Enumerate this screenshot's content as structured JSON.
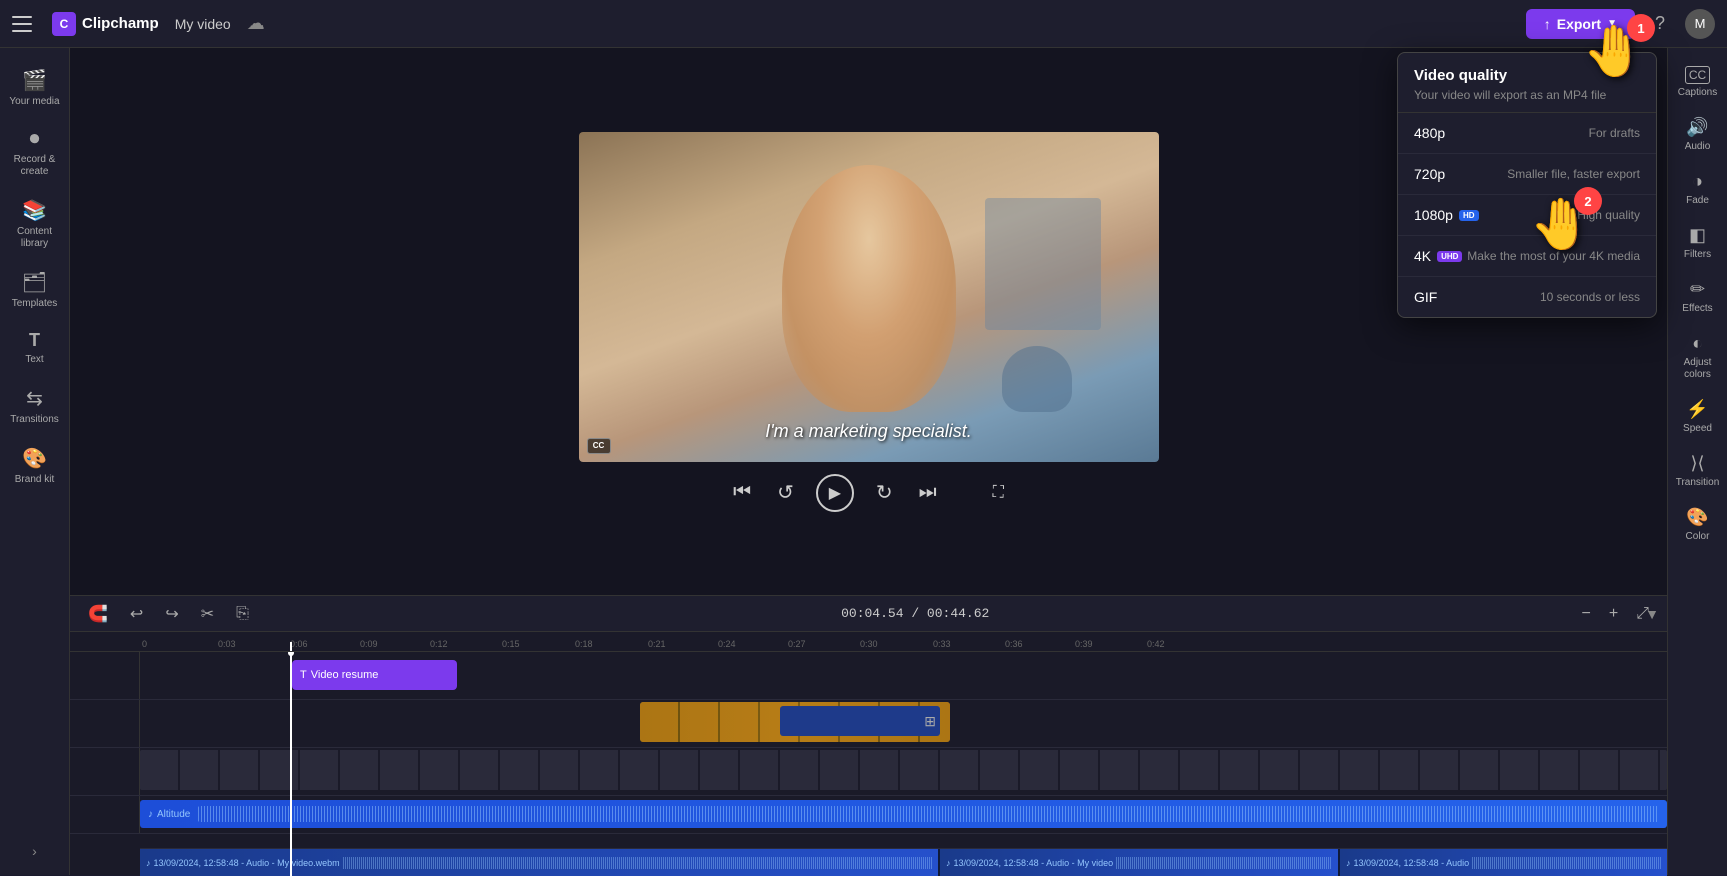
{
  "app": {
    "name": "Clipchamp",
    "title": "My video",
    "export_label": "Export",
    "help_icon": "?",
    "avatar_label": "M"
  },
  "sidebar_left": {
    "items": [
      {
        "id": "your-media",
        "icon": "🎬",
        "label": "Your media"
      },
      {
        "id": "record-create",
        "icon": "⏺",
        "label": "Record & create"
      },
      {
        "id": "content-library",
        "icon": "📚",
        "label": "Content library"
      },
      {
        "id": "templates",
        "icon": "🗂",
        "label": "Templates"
      },
      {
        "id": "text",
        "icon": "T",
        "label": "Text"
      },
      {
        "id": "transitions",
        "icon": "🔀",
        "label": "Transitions"
      },
      {
        "id": "brand-kit",
        "icon": "🎨",
        "label": "Brand kit"
      }
    ],
    "expand_icon": "›"
  },
  "sidebar_right": {
    "items": [
      {
        "id": "captions",
        "icon": "CC",
        "label": "Captions"
      },
      {
        "id": "audio",
        "icon": "🔊",
        "label": "Audio"
      },
      {
        "id": "fade",
        "icon": "◑",
        "label": "Fade"
      },
      {
        "id": "filters",
        "icon": "◧",
        "label": "Filters"
      },
      {
        "id": "effects",
        "icon": "✏",
        "label": "Effects"
      },
      {
        "id": "adjust-colors",
        "icon": "◐",
        "label": "Adjust colors"
      },
      {
        "id": "speed",
        "icon": "⚡",
        "label": "Speed"
      },
      {
        "id": "transition",
        "icon": "⟩",
        "label": "Transition"
      },
      {
        "id": "color",
        "icon": "🎨",
        "label": "Color"
      }
    ]
  },
  "video_quality": {
    "title": "Video quality",
    "subtitle": "Your video will export as an MP4 file",
    "options": [
      {
        "id": "480p",
        "label": "480p",
        "badge": null,
        "badge_type": null,
        "desc": "For drafts"
      },
      {
        "id": "720p",
        "label": "720p",
        "badge": null,
        "badge_type": null,
        "desc": "Smaller file, faster export"
      },
      {
        "id": "1080p",
        "label": "1080p",
        "badge": "HD",
        "badge_type": "hd",
        "desc": "High quality"
      },
      {
        "id": "4k",
        "label": "4K",
        "badge": "UHD",
        "badge_type": "uhd",
        "desc": "Make the most of your 4K media"
      },
      {
        "id": "gif",
        "label": "GIF",
        "badge": null,
        "badge_type": null,
        "desc": "10 seconds or less"
      }
    ]
  },
  "player": {
    "subtitle": "I'm a marketing specialist.",
    "time_current": "00:04.54",
    "time_total": "00:44.62",
    "time_separator": " / "
  },
  "timeline": {
    "time_display": "00:04.54 / 00:44.62",
    "tracks": [
      {
        "id": "video-track",
        "clip_label": "Video resume",
        "clip_icon": "T"
      },
      {
        "id": "b-roll",
        "label": ""
      },
      {
        "id": "main-video",
        "label": ""
      },
      {
        "id": "music-track",
        "label": "Altitude"
      },
      {
        "id": "audio-1",
        "label": "13/09/2024, 12:58:48 - Audio - My video.webm"
      },
      {
        "id": "audio-2",
        "label": "13/09/2024, 12:58:48 - Audio - My video"
      },
      {
        "id": "audio-3",
        "label": "13/09/2024, 12:58:48 - Audio"
      }
    ],
    "ruler_marks": [
      "00",
      "0:03",
      "0:06",
      "0:09",
      "0:12",
      "0:15",
      "0:18",
      "0:21",
      "0:24",
      "0:27",
      "0:30",
      "0:33",
      "0:36",
      "0:39",
      "0:42"
    ]
  },
  "annotations": {
    "cursor1_number": "1",
    "cursor2_number": "2"
  }
}
